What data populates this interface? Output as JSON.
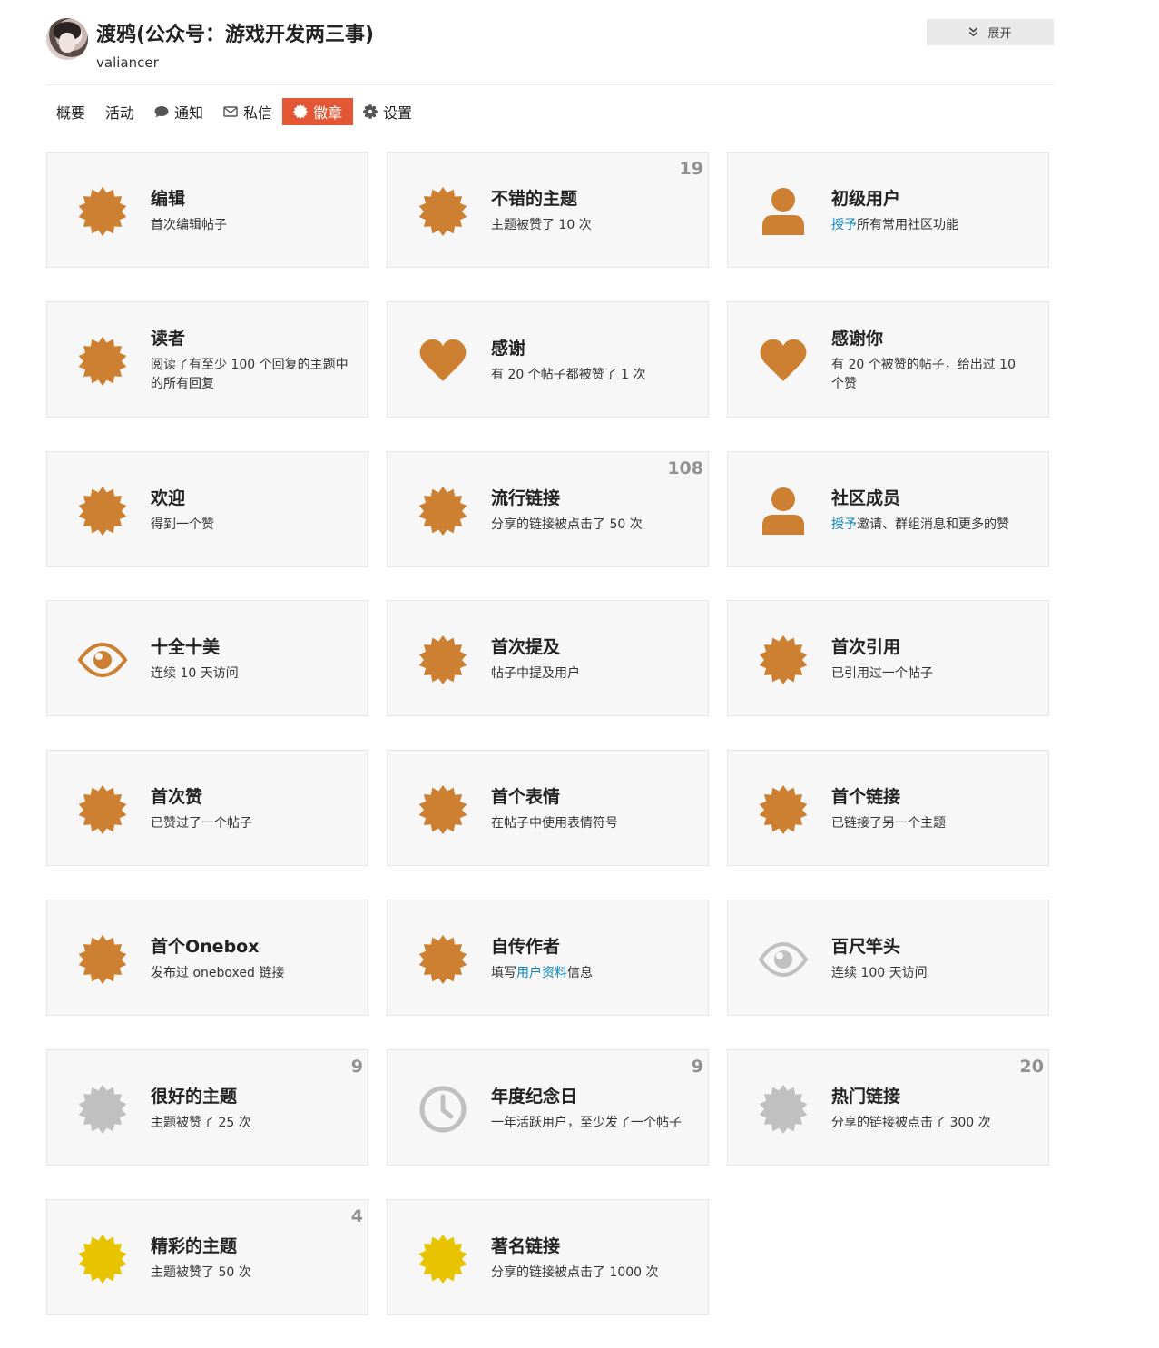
{
  "user": {
    "name": "渡鸦(公众号：游戏开发两三事)",
    "handle": "valiancer",
    "expand_label": "展开"
  },
  "nav": [
    {
      "label": "概要",
      "icon": "",
      "active": false
    },
    {
      "label": "活动",
      "icon": "",
      "active": false
    },
    {
      "label": "通知",
      "icon": "comment-icon",
      "active": false
    },
    {
      "label": "私信",
      "icon": "envelope-icon",
      "active": false
    },
    {
      "label": "徽章",
      "icon": "badge-icon",
      "active": true
    },
    {
      "label": "设置",
      "icon": "gear-icon",
      "active": false
    }
  ],
  "colors": {
    "bronze": "#cd7f32",
    "silver": "#c0c0c0",
    "gold": "#e7c300",
    "active_tab": "#e45735",
    "link": "#0a86c0"
  },
  "badges": [
    {
      "title": "编辑",
      "desc": [
        {
          "t": "首次编辑帖子"
        }
      ],
      "icon": "badge-icon",
      "tier": "bronze",
      "count": ""
    },
    {
      "title": "不错的主题",
      "desc": [
        {
          "t": "主题被赞了 10 次"
        }
      ],
      "icon": "badge-icon",
      "tier": "bronze",
      "count": "19"
    },
    {
      "title": "初级用户",
      "desc": [
        {
          "t": "授予",
          "link": true
        },
        {
          "t": "所有常用社区功能"
        }
      ],
      "icon": "user-icon",
      "tier": "bronze",
      "count": ""
    },
    {
      "title": "读者",
      "desc": [
        {
          "t": "阅读了有至少 100 个回复的主题中的所有回复"
        }
      ],
      "icon": "badge-icon",
      "tier": "bronze",
      "count": ""
    },
    {
      "title": "感谢",
      "desc": [
        {
          "t": "有 20 个帖子都被赞了 1 次"
        }
      ],
      "icon": "heart-icon",
      "tier": "bronze",
      "count": ""
    },
    {
      "title": "感谢你",
      "desc": [
        {
          "t": "有 20 个被赞的帖子，给出过 10 个赞"
        }
      ],
      "icon": "heart-icon",
      "tier": "bronze",
      "count": ""
    },
    {
      "title": "欢迎",
      "desc": [
        {
          "t": "得到一个赞"
        }
      ],
      "icon": "badge-icon",
      "tier": "bronze",
      "count": ""
    },
    {
      "title": "流行链接",
      "desc": [
        {
          "t": "分享的链接被点击了 50 次"
        }
      ],
      "icon": "badge-icon",
      "tier": "bronze",
      "count": "108"
    },
    {
      "title": "社区成员",
      "desc": [
        {
          "t": "授予",
          "link": true
        },
        {
          "t": "邀请、群组消息和更多的赞"
        }
      ],
      "icon": "user-icon",
      "tier": "bronze",
      "count": ""
    },
    {
      "title": "十全十美",
      "desc": [
        {
          "t": "连续 10 天访问"
        }
      ],
      "icon": "eye-icon",
      "tier": "bronze",
      "count": ""
    },
    {
      "title": "首次提及",
      "desc": [
        {
          "t": "帖子中提及用户"
        }
      ],
      "icon": "badge-icon",
      "tier": "bronze",
      "count": ""
    },
    {
      "title": "首次引用",
      "desc": [
        {
          "t": "已引用过一个帖子"
        }
      ],
      "icon": "badge-icon",
      "tier": "bronze",
      "count": ""
    },
    {
      "title": "首次赞",
      "desc": [
        {
          "t": "已赞过了一个帖子"
        }
      ],
      "icon": "badge-icon",
      "tier": "bronze",
      "count": ""
    },
    {
      "title": "首个表情",
      "desc": [
        {
          "t": "在帖子中使用表情符号"
        }
      ],
      "icon": "badge-icon",
      "tier": "bronze",
      "count": ""
    },
    {
      "title": "首个链接",
      "desc": [
        {
          "t": "已链接了另一个主题"
        }
      ],
      "icon": "badge-icon",
      "tier": "bronze",
      "count": ""
    },
    {
      "title": "首个Onebox",
      "desc": [
        {
          "t": "发布过 oneboxed 链接"
        }
      ],
      "icon": "badge-icon",
      "tier": "bronze",
      "count": ""
    },
    {
      "title": "自传作者",
      "desc": [
        {
          "t": "填写"
        },
        {
          "t": "用户资料",
          "link": true
        },
        {
          "t": "信息"
        }
      ],
      "icon": "badge-icon",
      "tier": "bronze",
      "count": ""
    },
    {
      "title": "百尺竿头",
      "desc": [
        {
          "t": "连续 100 天访问"
        }
      ],
      "icon": "eye-icon",
      "tier": "silver",
      "count": ""
    },
    {
      "title": "很好的主题",
      "desc": [
        {
          "t": "主题被赞了 25 次"
        }
      ],
      "icon": "badge-icon",
      "tier": "silver",
      "count": "9"
    },
    {
      "title": "年度纪念日",
      "desc": [
        {
          "t": "一年活跃用户，至少发了一个帖子"
        }
      ],
      "icon": "clock-icon",
      "tier": "silver",
      "count": "9"
    },
    {
      "title": "热门链接",
      "desc": [
        {
          "t": "分享的链接被点击了 300 次"
        }
      ],
      "icon": "badge-icon",
      "tier": "silver",
      "count": "20"
    },
    {
      "title": "精彩的主题",
      "desc": [
        {
          "t": "主题被赞了 50 次"
        }
      ],
      "icon": "badge-icon",
      "tier": "gold",
      "count": "4"
    },
    {
      "title": "著名链接",
      "desc": [
        {
          "t": "分享的链接被点击了 1000 次"
        }
      ],
      "icon": "badge-icon",
      "tier": "gold",
      "count": ""
    }
  ]
}
